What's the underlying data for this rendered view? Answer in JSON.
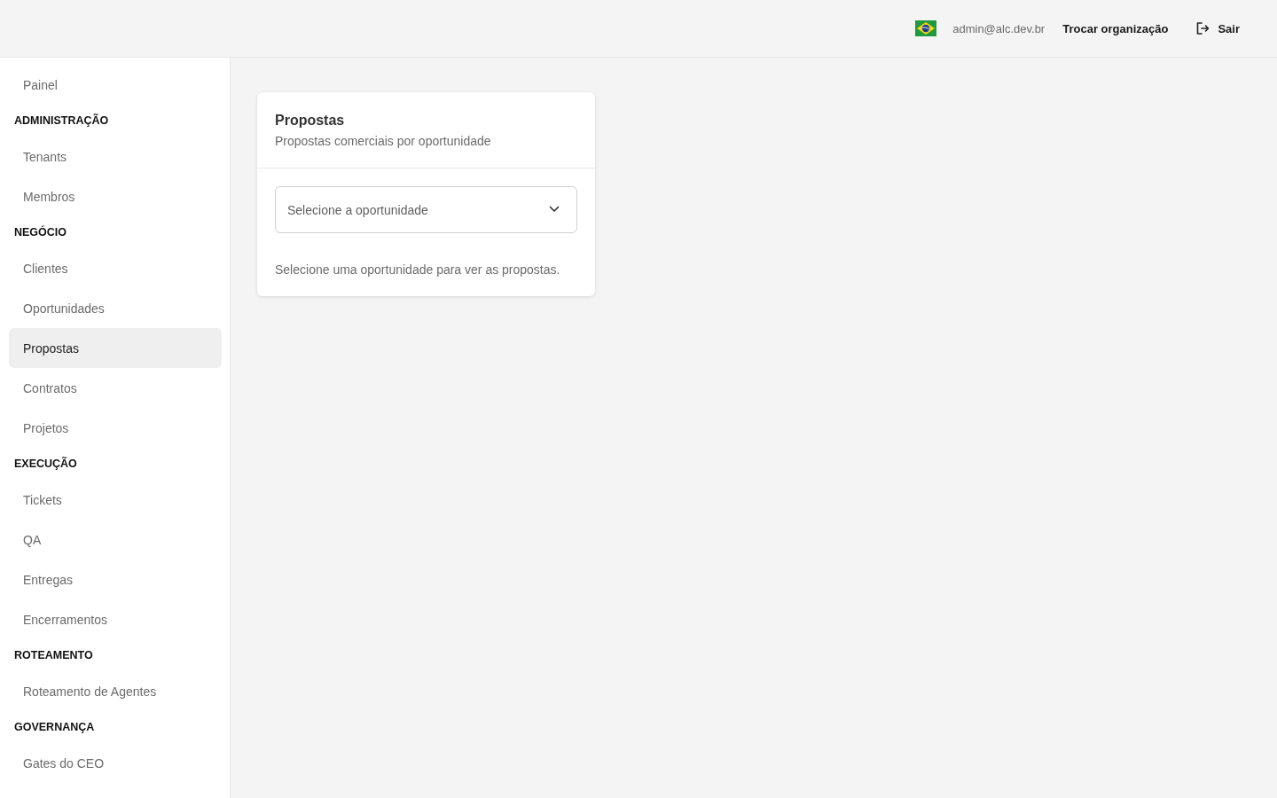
{
  "header": {
    "user_email": "admin@alc.dev.br",
    "switch_org_link": "Trocar organização",
    "logout_button": "Sair"
  },
  "sidebar": {
    "items": [
      {
        "label": "Painel",
        "selected": false
      }
    ],
    "sections": [
      {
        "title": "ADMINISTRAÇÃO",
        "items": [
          {
            "label": "Tenants",
            "selected": false
          },
          {
            "label": "Membros",
            "selected": false
          }
        ]
      },
      {
        "title": "NEGÓCIO",
        "items": [
          {
            "label": "Clientes",
            "selected": false
          },
          {
            "label": "Oportunidades",
            "selected": false
          },
          {
            "label": "Propostas",
            "selected": true
          },
          {
            "label": "Contratos",
            "selected": false
          },
          {
            "label": "Projetos",
            "selected": false
          }
        ]
      },
      {
        "title": "EXECUÇÃO",
        "items": [
          {
            "label": "Tickets",
            "selected": false
          },
          {
            "label": "QA",
            "selected": false
          },
          {
            "label": "Entregas",
            "selected": false
          },
          {
            "label": "Encerramentos",
            "selected": false
          }
        ]
      },
      {
        "title": "ROTEAMENTO",
        "items": [
          {
            "label": "Roteamento de Agentes",
            "selected": false
          }
        ]
      },
      {
        "title": "GOVERNANÇA",
        "items": [
          {
            "label": "Gates do CEO",
            "selected": false
          }
        ]
      }
    ]
  },
  "card": {
    "title": "Propostas",
    "subtitle": "Propostas comerciais por oportunidade",
    "select": {
      "placeholder": "Selecione a oportunidade"
    },
    "empty_message": "Selecione uma oportunidade para ver as propostas."
  }
}
